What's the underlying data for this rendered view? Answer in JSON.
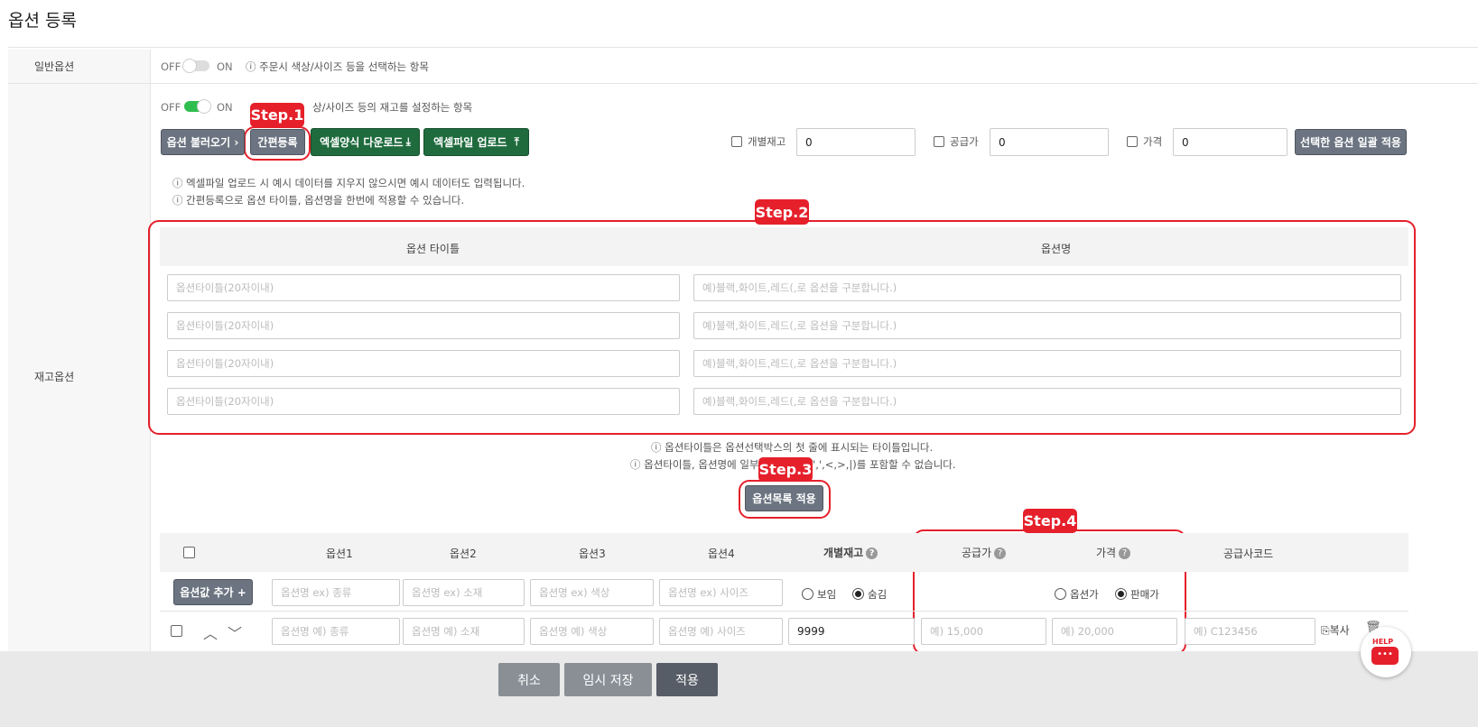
{
  "page": {
    "title": "옵션 등록"
  },
  "general_option": {
    "label": "일반옵션",
    "off": "OFF",
    "on": "ON",
    "description": "ⓘ 주문시 색상/사이즈 등을 선택하는 항목"
  },
  "stock_option": {
    "label": "재고옵션",
    "off": "OFF",
    "on": "ON",
    "description": "ⓘ 주문시 색상/사이즈 등의 재고를 설정하는 항목",
    "description_visible": "상/사이즈 등의 재고를 설정하는 항목",
    "toggle_on": true
  },
  "toolbar": {
    "load_options": "옵션 불러오기 ›",
    "quick_register": "간편등록",
    "excel_download": "엑셀양식 다운로드",
    "excel_upload": "엑셀파일 업로드",
    "individual_stock_label": "개별재고",
    "individual_stock_value": "0",
    "supply_price_label": "공급가",
    "supply_price_value": "0",
    "price_label": "가격",
    "price_value": "0",
    "apply_bulk": "선택한 옵션 일괄 적용"
  },
  "notes": {
    "excel_note": "ⓘ 엑셀파일 업로드 시 예시 데이터를 지우지 않으시면 예시 데이터도 입력됩니다.",
    "quick_note": "ⓘ 간편등록으로 옵션 타이틀, 옵션명을 한번에 적용할 수 있습니다.",
    "title_note": "ⓘ 옵션타이틀은 옵션선택박스의 첫 줄에 표시되는 타이틀입니다.",
    "special_note_left": "ⓘ 옵션타이틀, 옵션명에 일부",
    "special_note_right": "\",',<,>,|)를 포함할 수 없습니다."
  },
  "steps": {
    "step1": "Step.1",
    "step2": "Step.2",
    "step3": "Step.3",
    "step4": "Step.4"
  },
  "quick_table": {
    "col_title": "옵션 타이틀",
    "col_name": "옵션명",
    "title_placeholder": "옵션타이틀(20자이내)",
    "name_placeholder": "예)블랙,화이트,레드(,로 옵션을 구분합니다.)"
  },
  "apply_list_button": "옵션목록 적용",
  "option_table": {
    "headers": [
      "옵션1",
      "옵션2",
      "옵션3",
      "옵션4",
      "개별재고",
      "공급가",
      "가격",
      "공급사코드"
    ],
    "add_value_button": "옵션값 추가 +",
    "placeholders_ex": [
      "옵션명 ex) 종류",
      "옵션명 ex) 소재",
      "옵션명 ex) 색상",
      "옵션명 ex) 사이즈"
    ],
    "radio_show": "보임",
    "radio_hide": "숨김",
    "radio_option_price": "옵션가",
    "radio_sale_price": "판매가",
    "row": {
      "placeholders": [
        "옵션명 예) 종류",
        "옵션명 예) 소재",
        "옵션명 예) 색상",
        "옵션명 예) 사이즈"
      ],
      "stock_value": "9999",
      "supply_placeholder": "예) 15,000",
      "price_placeholder": "예) 20,000",
      "code_placeholder": "예) C123456",
      "copy_label": "복사"
    }
  },
  "footer": {
    "cancel": "취소",
    "temp_save": "임시 저장",
    "apply": "적용"
  },
  "help": {
    "label": "HELP"
  },
  "colors": {
    "accent_red": "#e5202b",
    "btn_gray": "#6b7480",
    "btn_green": "#1f6b3e",
    "toggle_green": "#2ebd4e"
  }
}
